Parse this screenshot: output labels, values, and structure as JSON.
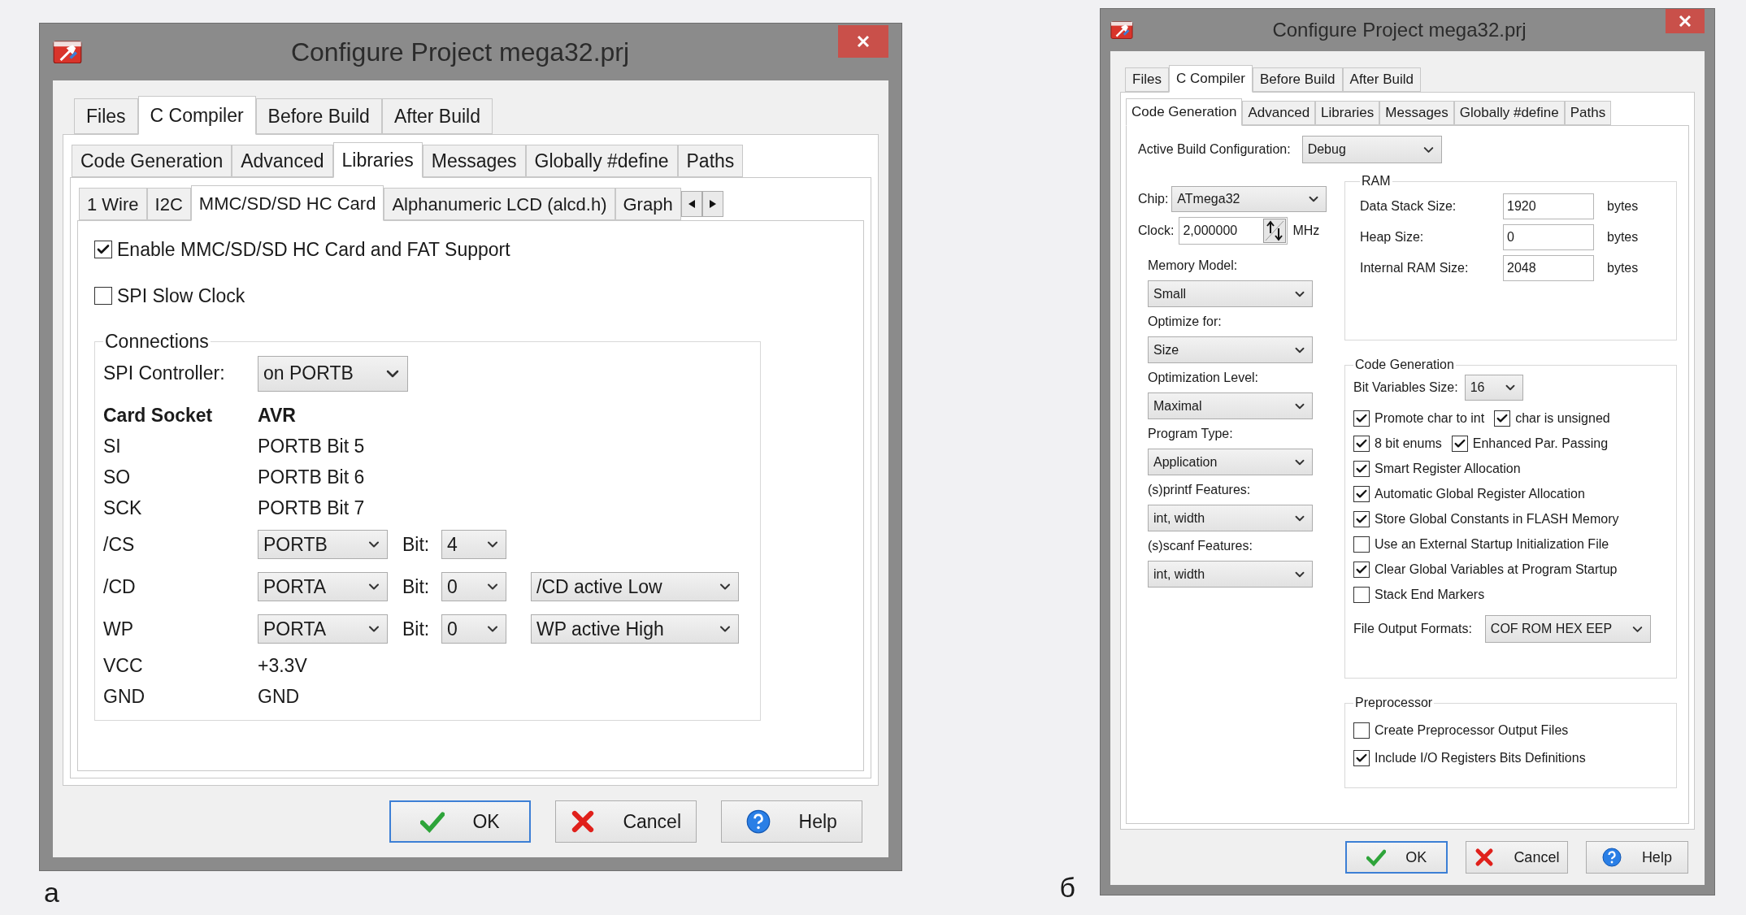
{
  "figures": [
    {
      "caption": "а",
      "dialog": {
        "kind": "libraries",
        "title": "Configure Project mega32.prj",
        "tabs": [
          {
            "label": "Files",
            "selected": false
          },
          {
            "label": "C Compiler",
            "selected": true
          },
          {
            "label": "Before Build",
            "selected": false
          },
          {
            "label": "After Build",
            "selected": false
          }
        ],
        "subtabs": [
          {
            "label": "Code Generation",
            "selected": false
          },
          {
            "label": "Advanced",
            "selected": false
          },
          {
            "label": "Libraries",
            "selected": true
          },
          {
            "label": "Messages",
            "selected": false
          },
          {
            "label": "Globally #define",
            "selected": false
          },
          {
            "label": "Paths",
            "selected": false
          }
        ],
        "lib_tabs": [
          {
            "label": "1 Wire",
            "selected": false
          },
          {
            "label": "I2C",
            "selected": false
          },
          {
            "label": "MMC/SD/SD HC Card",
            "selected": true
          },
          {
            "label": "Alphanumeric LCD (alcd.h)",
            "selected": false
          },
          {
            "label": "Graph",
            "selected": false
          }
        ],
        "checkboxes": [
          {
            "label": "Enable MMC/SD/SD HC Card and FAT Support",
            "checked": true
          },
          {
            "label": "SPI Slow Clock",
            "checked": false
          }
        ],
        "connections": {
          "title": "Connections",
          "spi_label": "SPI Controller:",
          "spi_value": "on PORTB",
          "header": [
            "Card Socket",
            "AVR"
          ],
          "rows": [
            {
              "kind": "text",
              "pin": "SI",
              "value": "PORTB Bit 5"
            },
            {
              "kind": "text",
              "pin": "SO",
              "value": "PORTB Bit 6"
            },
            {
              "kind": "text",
              "pin": "SCK",
              "value": "PORTB Bit 7"
            },
            {
              "kind": "select",
              "pin": "/CS",
              "port": "PORTB",
              "bit_label": "Bit:",
              "bit": "4"
            },
            {
              "kind": "select",
              "pin": "/CD",
              "port": "PORTA",
              "bit_label": "Bit:",
              "bit": "0",
              "mode": "/CD active Low"
            },
            {
              "kind": "select",
              "pin": "WP",
              "port": "PORTA",
              "bit_label": "Bit:",
              "bit": "0",
              "mode": "WP active High"
            },
            {
              "kind": "text",
              "pin": "VCC",
              "value": "+3.3V"
            },
            {
              "kind": "text",
              "pin": "GND",
              "value": "GND"
            }
          ]
        },
        "buttons": [
          {
            "kind": "ok",
            "label": "OK",
            "focused": true
          },
          {
            "kind": "cancel",
            "label": "Cancel",
            "focused": false
          },
          {
            "kind": "help",
            "label": "Help",
            "focused": false
          }
        ]
      }
    },
    {
      "caption": "б",
      "dialog": {
        "kind": "code_generation",
        "title": "Configure Project mega32.prj",
        "tabs": [
          {
            "label": "Files",
            "selected": false
          },
          {
            "label": "C Compiler",
            "selected": true
          },
          {
            "label": "Before Build",
            "selected": false
          },
          {
            "label": "After Build",
            "selected": false
          }
        ],
        "subtabs": [
          {
            "label": "Code Generation",
            "selected": true
          },
          {
            "label": "Advanced",
            "selected": false
          },
          {
            "label": "Libraries",
            "selected": false
          },
          {
            "label": "Messages",
            "selected": false
          },
          {
            "label": "Globally #define",
            "selected": false
          },
          {
            "label": "Paths",
            "selected": false
          }
        ],
        "active_config": {
          "label": "Active Build Configuration:",
          "value": "Debug"
        },
        "chip": {
          "label": "Chip:",
          "value": "ATmega32"
        },
        "clock": {
          "label": "Clock:",
          "value": "2,000000",
          "unit": "MHz"
        },
        "selects": [
          {
            "label": "Memory Model:",
            "value": "Small"
          },
          {
            "label": "Optimize for:",
            "value": "Size"
          },
          {
            "label": "Optimization Level:",
            "value": "Maximal"
          },
          {
            "label": "Program Type:",
            "value": "Application"
          },
          {
            "label": "(s)printf Features:",
            "value": "int, width"
          },
          {
            "label": "(s)scanf Features:",
            "value": "int, width"
          }
        ],
        "ram": {
          "title": "RAM",
          "rows": [
            {
              "label": "Data Stack Size:",
              "value": "1920",
              "unit": "bytes"
            },
            {
              "label": "Heap Size:",
              "value": "0",
              "unit": "bytes"
            },
            {
              "label": "Internal RAM Size:",
              "value": "2048",
              "unit": "bytes"
            }
          ]
        },
        "code_generation": {
          "title": "Code Generation",
          "bit_size": {
            "label": "Bit Variables Size:",
            "value": "16"
          },
          "rows": [
            [
              {
                "label": "Promote char to int",
                "checked": true
              },
              {
                "label": "char is unsigned",
                "checked": true
              }
            ],
            [
              {
                "label": "8 bit enums",
                "checked": true
              },
              {
                "label": "Enhanced Par. Passing",
                "checked": true
              }
            ],
            [
              {
                "label": "Smart Register Allocation",
                "checked": true
              }
            ],
            [
              {
                "label": "Automatic Global Register Allocation",
                "checked": true
              }
            ],
            [
              {
                "label": "Store Global Constants in FLASH Memory",
                "checked": true
              }
            ],
            [
              {
                "label": "Use an External Startup Initialization File",
                "checked": false
              }
            ],
            [
              {
                "label": "Clear Global Variables at Program Startup",
                "checked": true
              }
            ],
            [
              {
                "label": "Stack End Markers",
                "checked": false
              }
            ]
          ],
          "file_output": {
            "label": "File Output Formats:",
            "value": "COF ROM HEX EEP"
          }
        },
        "preprocessor": {
          "title": "Preprocessor",
          "checks": [
            {
              "label": "Create Preprocessor Output Files",
              "checked": false
            },
            {
              "label": "Include I/O Registers Bits Definitions",
              "checked": true
            }
          ]
        },
        "buttons": [
          {
            "kind": "ok",
            "label": "OK",
            "focused": true
          },
          {
            "kind": "cancel",
            "label": "Cancel",
            "focused": false
          },
          {
            "kind": "help",
            "label": "Help",
            "focused": false
          }
        ]
      }
    }
  ]
}
